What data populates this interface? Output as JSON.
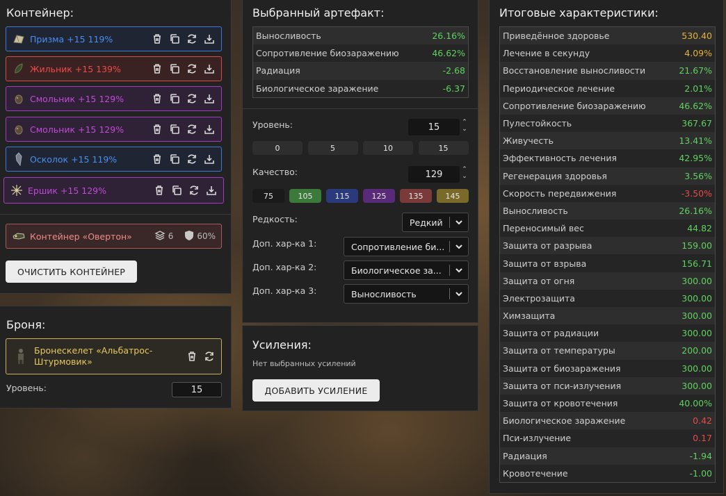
{
  "container": {
    "title": "Контейнер:",
    "items": [
      {
        "label": "Призма +15 119%",
        "color": "#4a8ef0",
        "bg": "#1f2533",
        "border": "#3f78d8",
        "icon": "prism-artifact-icon"
      },
      {
        "label": "Жильник +15 139%",
        "color": "#f04a4a",
        "bg": "#3a2222",
        "border": "#d84a4a",
        "icon": "zhilnik-artifact-icon"
      },
      {
        "label": "Смольник +15 129%",
        "color": "#c24ad8",
        "bg": "#2f2236",
        "border": "#a23cc0",
        "icon": "smolnik-artifact-icon"
      },
      {
        "label": "Смольник +15 129%",
        "color": "#c24ad8",
        "bg": "#2f2236",
        "border": "#a23cc0",
        "icon": "smolnik-artifact-icon"
      },
      {
        "label": "Осколок +15 119%",
        "color": "#4a8ef0",
        "bg": "#1f2533",
        "border": "#3f78d8",
        "icon": "shard-artifact-icon"
      },
      {
        "label": "Ершик +15 129%",
        "color": "#c24ad8",
        "bg": "#2f2236",
        "border": "#a23cc0",
        "icon": "ershik-artifact-icon"
      }
    ],
    "item_actions": [
      "trash-icon",
      "copy-icon",
      "swap-icon",
      "download-icon"
    ],
    "cont_box": {
      "label": "Контейнер «Овертон»",
      "slots": "6",
      "protection": "60%"
    },
    "clear_button": "ОЧИСТИТЬ КОНТЕЙНЕР"
  },
  "armor": {
    "title": "Броня:",
    "name_line1": "Бронескелет «Альбатрос-",
    "name_line2": "Штурмовик»",
    "level_label": "Уровень:",
    "level_value": "15"
  },
  "artifact": {
    "title": "Выбранный артефакт:",
    "stats": [
      {
        "name": "Выносливость",
        "value": "26.16%",
        "tone": "pos"
      },
      {
        "name": "Сопротивление биозаражению",
        "value": "46.62%",
        "tone": "pos"
      },
      {
        "name": "Радиация",
        "value": "-2.68",
        "tone": "pos"
      },
      {
        "name": "Биологическое заражение",
        "value": "-6.37",
        "tone": "pos"
      }
    ],
    "level_label": "Уровень:",
    "level_value": "15",
    "level_presets": [
      "0",
      "5",
      "10",
      "15"
    ],
    "quality_label": "Качество:",
    "quality_value": "129",
    "quality_presets": [
      {
        "label": "75",
        "color": "#1a1a1a"
      },
      {
        "label": "105",
        "color": "#3b7a3a"
      },
      {
        "label": "115",
        "color": "#2a3a7a"
      },
      {
        "label": "125",
        "color": "#5a2a7a"
      },
      {
        "label": "135",
        "color": "#7a3a3a"
      },
      {
        "label": "145",
        "color": "#7a6a2a"
      }
    ],
    "rarity_label": "Редкость:",
    "rarity_value": "Редкий",
    "extra1_label": "Доп. хар-ка 1:",
    "extra1_value": "Сопротивление би...",
    "extra2_label": "Доп. хар-ка 2:",
    "extra2_value": "Биологическое за...",
    "extra3_label": "Доп. хар-ка 3:",
    "extra3_value": "Выносливость"
  },
  "boosts": {
    "title": "Усиления:",
    "empty_text": "Нет выбранных усилений",
    "add_button": "ДОБАВИТЬ УСИЛЕНИЕ"
  },
  "totals": {
    "title": "Итоговые характеристики:",
    "stats": [
      {
        "name": "Приведённое здоровье",
        "value": "530.40",
        "tone": "gold"
      },
      {
        "name": "Лечение в секунду",
        "value": "4.09%",
        "tone": "gold"
      },
      {
        "name": "Восстановление выносливости",
        "value": "21.67%",
        "tone": "pos"
      },
      {
        "name": "Периодическое лечение",
        "value": "2.01%",
        "tone": "pos"
      },
      {
        "name": "Сопротивление биозаражению",
        "value": "46.62%",
        "tone": "pos"
      },
      {
        "name": "Пулестойкость",
        "value": "367.67",
        "tone": "pos"
      },
      {
        "name": "Живучесть",
        "value": "13.41%",
        "tone": "pos"
      },
      {
        "name": "Эффективность лечения",
        "value": "42.95%",
        "tone": "pos"
      },
      {
        "name": "Регенерация здоровья",
        "value": "3.56%",
        "tone": "pos"
      },
      {
        "name": "Скорость передвижения",
        "value": "-3.50%",
        "tone": "neg"
      },
      {
        "name": "Выносливость",
        "value": "26.16%",
        "tone": "pos"
      },
      {
        "name": "Переносимый вес",
        "value": "44.82",
        "tone": "pos"
      },
      {
        "name": "Защита от разрыва",
        "value": "159.00",
        "tone": "pos"
      },
      {
        "name": "Защита от взрыва",
        "value": "156.71",
        "tone": "pos"
      },
      {
        "name": "Защита от огня",
        "value": "300.00",
        "tone": "pos"
      },
      {
        "name": "Электрозащита",
        "value": "300.00",
        "tone": "pos"
      },
      {
        "name": "Химзащита",
        "value": "300.00",
        "tone": "pos"
      },
      {
        "name": "Защита от радиации",
        "value": "300.00",
        "tone": "pos"
      },
      {
        "name": "Защита от температуры",
        "value": "200.00",
        "tone": "pos"
      },
      {
        "name": "Защита от биозаражения",
        "value": "300.00",
        "tone": "pos"
      },
      {
        "name": "Защита от пси-излучения",
        "value": "300.00",
        "tone": "pos"
      },
      {
        "name": "Защита от кровотечения",
        "value": "40.00%",
        "tone": "pos"
      },
      {
        "name": "Биологическое заражение",
        "value": "0.42",
        "tone": "neg"
      },
      {
        "name": "Пси-излучение",
        "value": "0.17",
        "tone": "neg"
      },
      {
        "name": "Радиация",
        "value": "-1.94",
        "tone": "pos"
      },
      {
        "name": "Кровотечение",
        "value": "-1.00",
        "tone": "pos"
      }
    ]
  }
}
